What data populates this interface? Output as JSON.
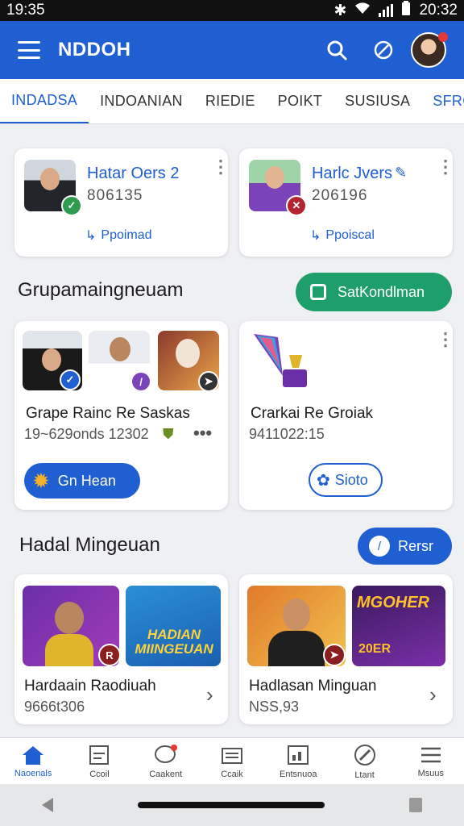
{
  "status": {
    "time_left": "19:35",
    "time_right": "20:32"
  },
  "appbar": {
    "title": "NDDOH"
  },
  "tabs": [
    "INDADSA",
    "INDOANIAN",
    "RIEDIE",
    "POIKT",
    "SUSIUSA",
    "SFRG"
  ],
  "contacts": [
    {
      "name": "Hatar Oers 2",
      "number": "806135",
      "link": "Ppoimad"
    },
    {
      "name": "Harlc Jvers",
      "number": "206196",
      "link": "Ppoiscal"
    }
  ],
  "section1": {
    "title": "Grupamaingneuam",
    "action": "SatKondlman",
    "cards": [
      {
        "title": "Grape Rainc Re Saskas",
        "sub": "19~629onds 12302",
        "button": "Gn Hean"
      },
      {
        "title": "Crarkai Re Groiak",
        "sub": "9411022:15",
        "button": "Sioto"
      }
    ]
  },
  "section2": {
    "title": "Hadal Mingeuan",
    "action": "Rersr",
    "cards": [
      {
        "title": "Hardaain Raodiuah",
        "sub": "9666t306",
        "banner": "HADIAN MIINGEUAN",
        "badge": "R"
      },
      {
        "title": "Hadlasan Minguan",
        "sub": "NSS,93",
        "banner": "MGOHER",
        "banner2": "20ER"
      }
    ]
  },
  "bottom_nav": [
    "Naoenals",
    "Ccoil",
    "Caakent",
    "Ccaik",
    "Entsnuoa",
    "Ltant",
    "Msuus"
  ],
  "colors": {
    "primary": "#1f5fd1",
    "green": "#1e9e6b",
    "red": "#e53935"
  }
}
